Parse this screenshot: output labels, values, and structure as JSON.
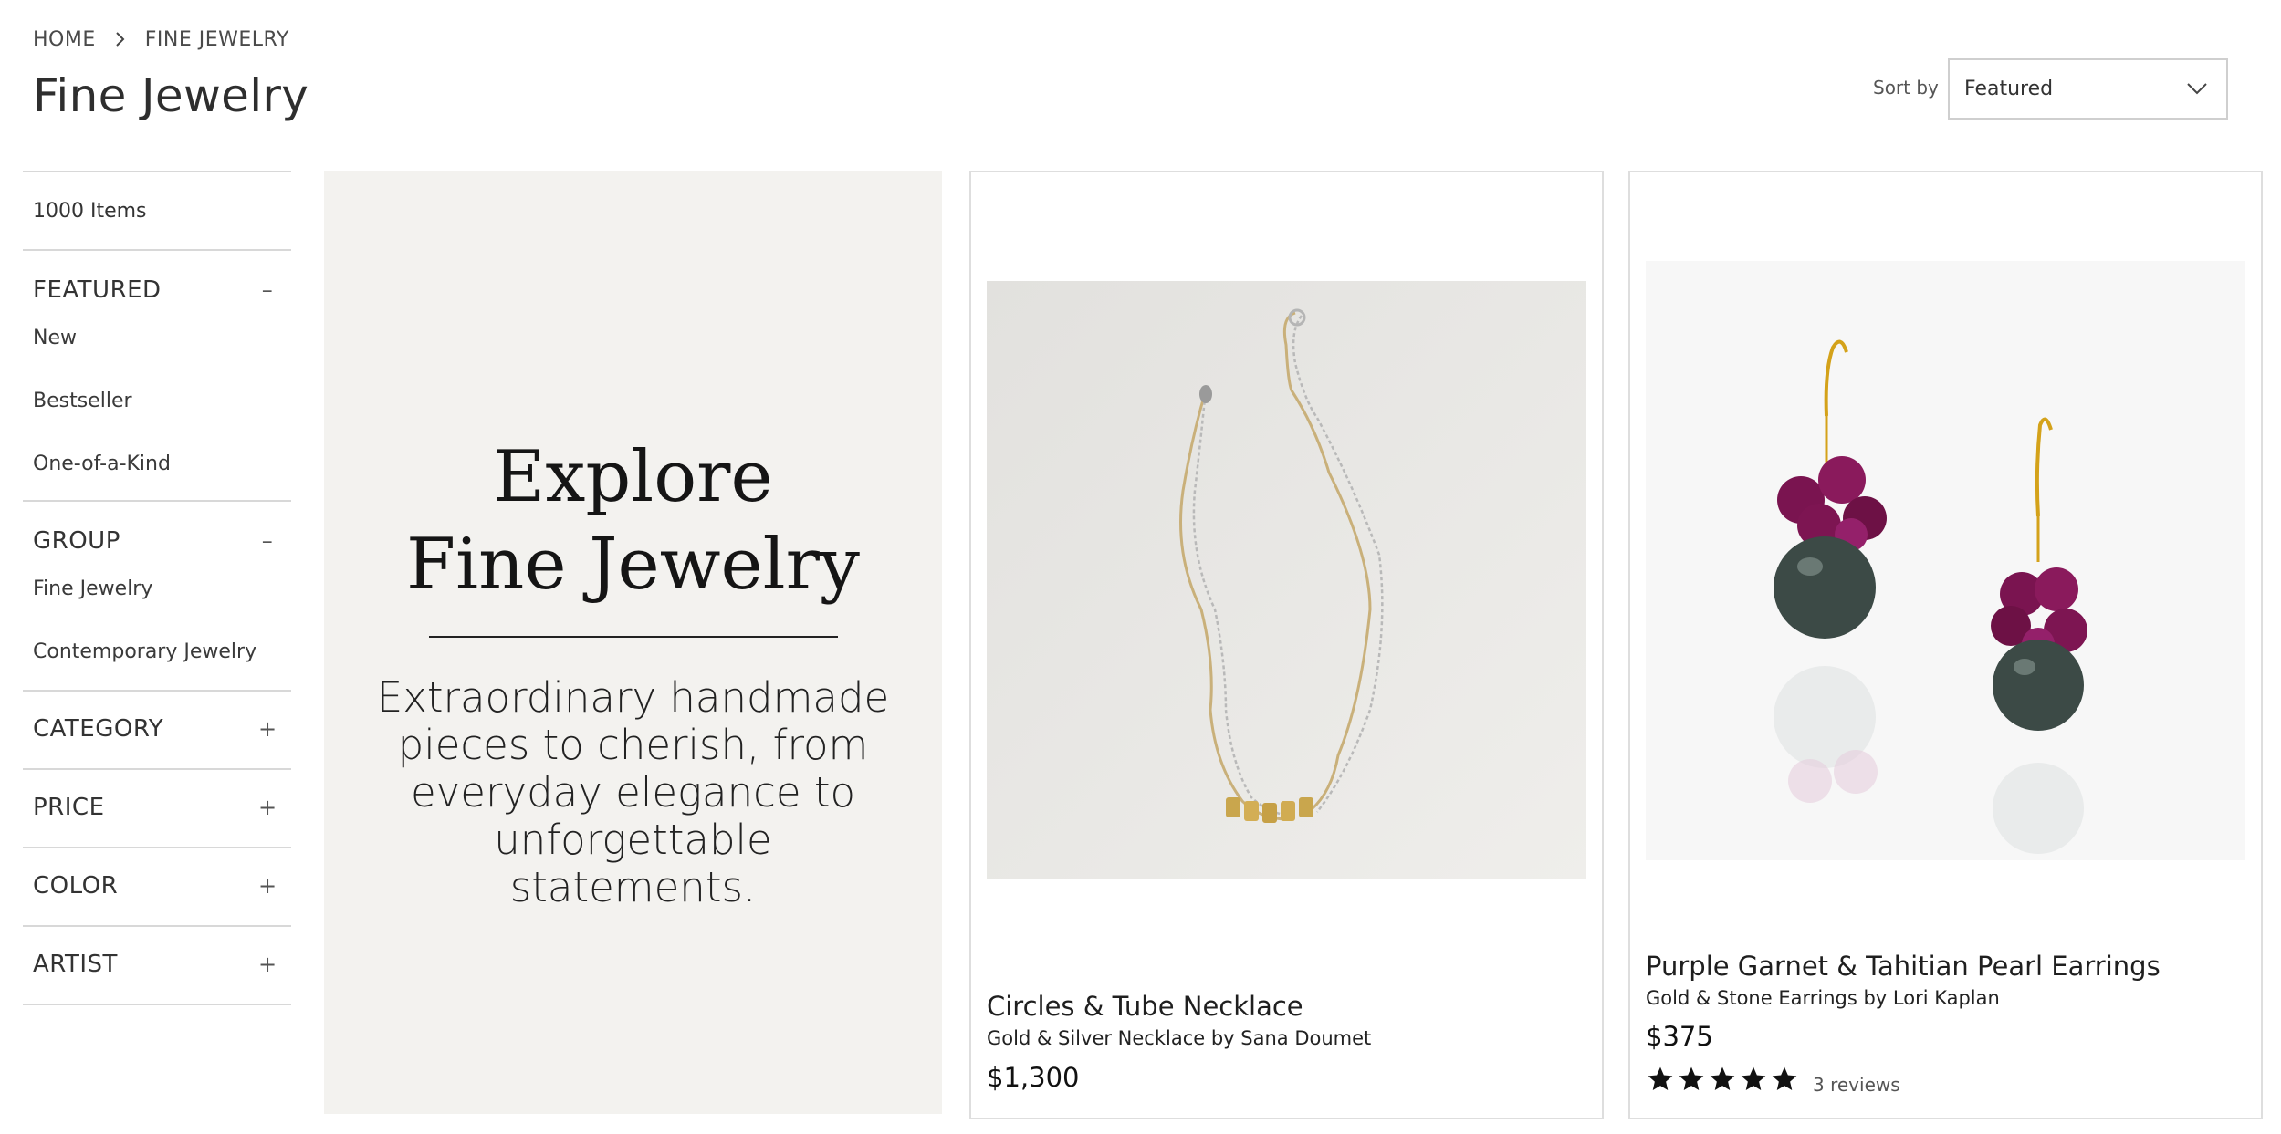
{
  "breadcrumb": {
    "home": "HOME",
    "current": "FINE JEWELRY"
  },
  "page": {
    "title": "Fine Jewelry"
  },
  "sort": {
    "label": "Sort by",
    "value": "Featured"
  },
  "sidebar": {
    "count": "1000 Items",
    "featured": {
      "title": "FEATURED",
      "toggle": "–",
      "items": [
        "New",
        "Bestseller",
        "One-of-a-Kind"
      ]
    },
    "group": {
      "title": "GROUP",
      "toggle": "–",
      "items": [
        "Fine Jewelry",
        "Contemporary Jewelry"
      ]
    },
    "collapsed": [
      {
        "title": "CATEGORY",
        "toggle": "+"
      },
      {
        "title": "PRICE",
        "toggle": "+"
      },
      {
        "title": "COLOR",
        "toggle": "+"
      },
      {
        "title": "ARTIST",
        "toggle": "+"
      }
    ]
  },
  "promo": {
    "title_line1": "Explore",
    "title_line2": "Fine Jewelry",
    "subtitle": "Extraordinary handmade pieces to cherish, from everyday elegance to unforgettable statements."
  },
  "products": [
    {
      "name": "Circles & Tube Necklace",
      "maker": "Gold & Silver Necklace by Sana Doumet",
      "price": "$1,300"
    },
    {
      "name": "Purple Garnet & Tahitian Pearl Earrings",
      "maker": "Gold & Stone Earrings by Lori Kaplan",
      "price": "$375",
      "rating": 5,
      "reviews": "3 reviews"
    }
  ],
  "colors": {
    "promo_bg": "#f3f2ef",
    "garnet": "#7a1450",
    "pearl": "#3c4a46",
    "gold": "#d4a21a"
  }
}
